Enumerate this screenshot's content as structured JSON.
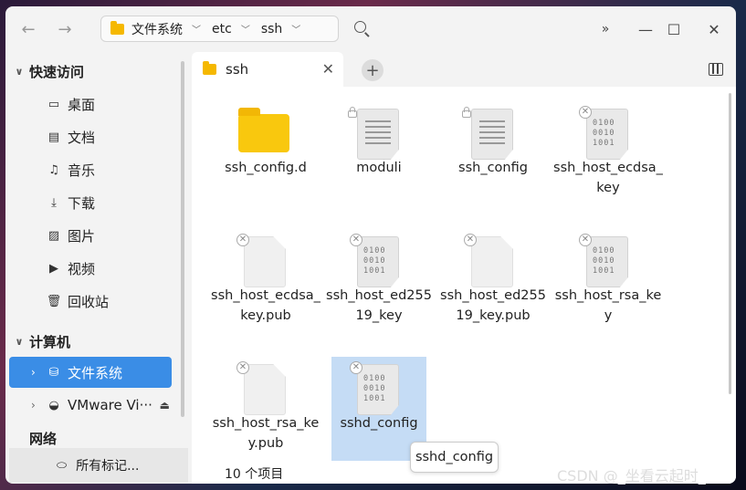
{
  "toolbar": {
    "breadcrumbs": [
      "文件系统",
      "etc",
      "ssh"
    ],
    "more_label": "»"
  },
  "sidebar": {
    "quick_access": "快速访问",
    "quick_items": [
      "桌面",
      "文档",
      "音乐",
      "下载",
      "图片",
      "视频",
      "回收站"
    ],
    "computer": "计算机",
    "computer_items": [
      "文件系统",
      "VMware Vi···"
    ],
    "network": "网络",
    "tags": "所有标记..."
  },
  "tab": {
    "title": "ssh"
  },
  "files": [
    {
      "name": "ssh_config.d",
      "type": "folder"
    },
    {
      "name": "moduli",
      "type": "text-locked"
    },
    {
      "name": "ssh_config",
      "type": "text-locked"
    },
    {
      "name": "ssh_host_ecdsa_key",
      "type": "binary-noaccess"
    },
    {
      "name": "ssh_host_ecdsa_key.pub",
      "type": "blank-noaccess"
    },
    {
      "name": "ssh_host_ed25519_key",
      "type": "binary-noaccess"
    },
    {
      "name": "ssh_host_ed25519_key.pub",
      "type": "blank-noaccess"
    },
    {
      "name": "ssh_host_rsa_key",
      "type": "binary-noaccess"
    },
    {
      "name": "ssh_host_rsa_key.pub",
      "type": "blank-noaccess"
    },
    {
      "name": "sshd_config",
      "type": "binary-noaccess",
      "selected": true
    }
  ],
  "tooltip": "sshd_config",
  "status": "10 个项目",
  "watermark": "CSDN @_坐看云起时_",
  "colors": {
    "accent": "#3a8de6",
    "selection": "#c5dcf5",
    "folder": "#f9c80e"
  }
}
